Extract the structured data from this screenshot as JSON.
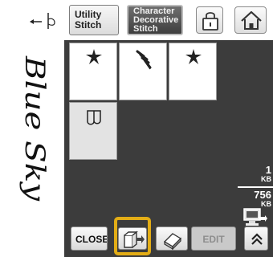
{
  "preview": {
    "text": "Blue Sky"
  },
  "tabs": {
    "utility": {
      "line1": "Utility",
      "line2": "Stitch"
    },
    "character": {
      "line1": "Character",
      "line2": "Decorative",
      "line3": "Stitch"
    }
  },
  "memory": {
    "used_value": "1",
    "used_unit": "KB",
    "free_value": "756",
    "free_unit": "KB"
  },
  "buttons": {
    "close_label": "CLOSE",
    "edit_label": "EDIT"
  },
  "colors": {
    "panel": "#3c3c3c",
    "highlight": "#e3ad16"
  }
}
